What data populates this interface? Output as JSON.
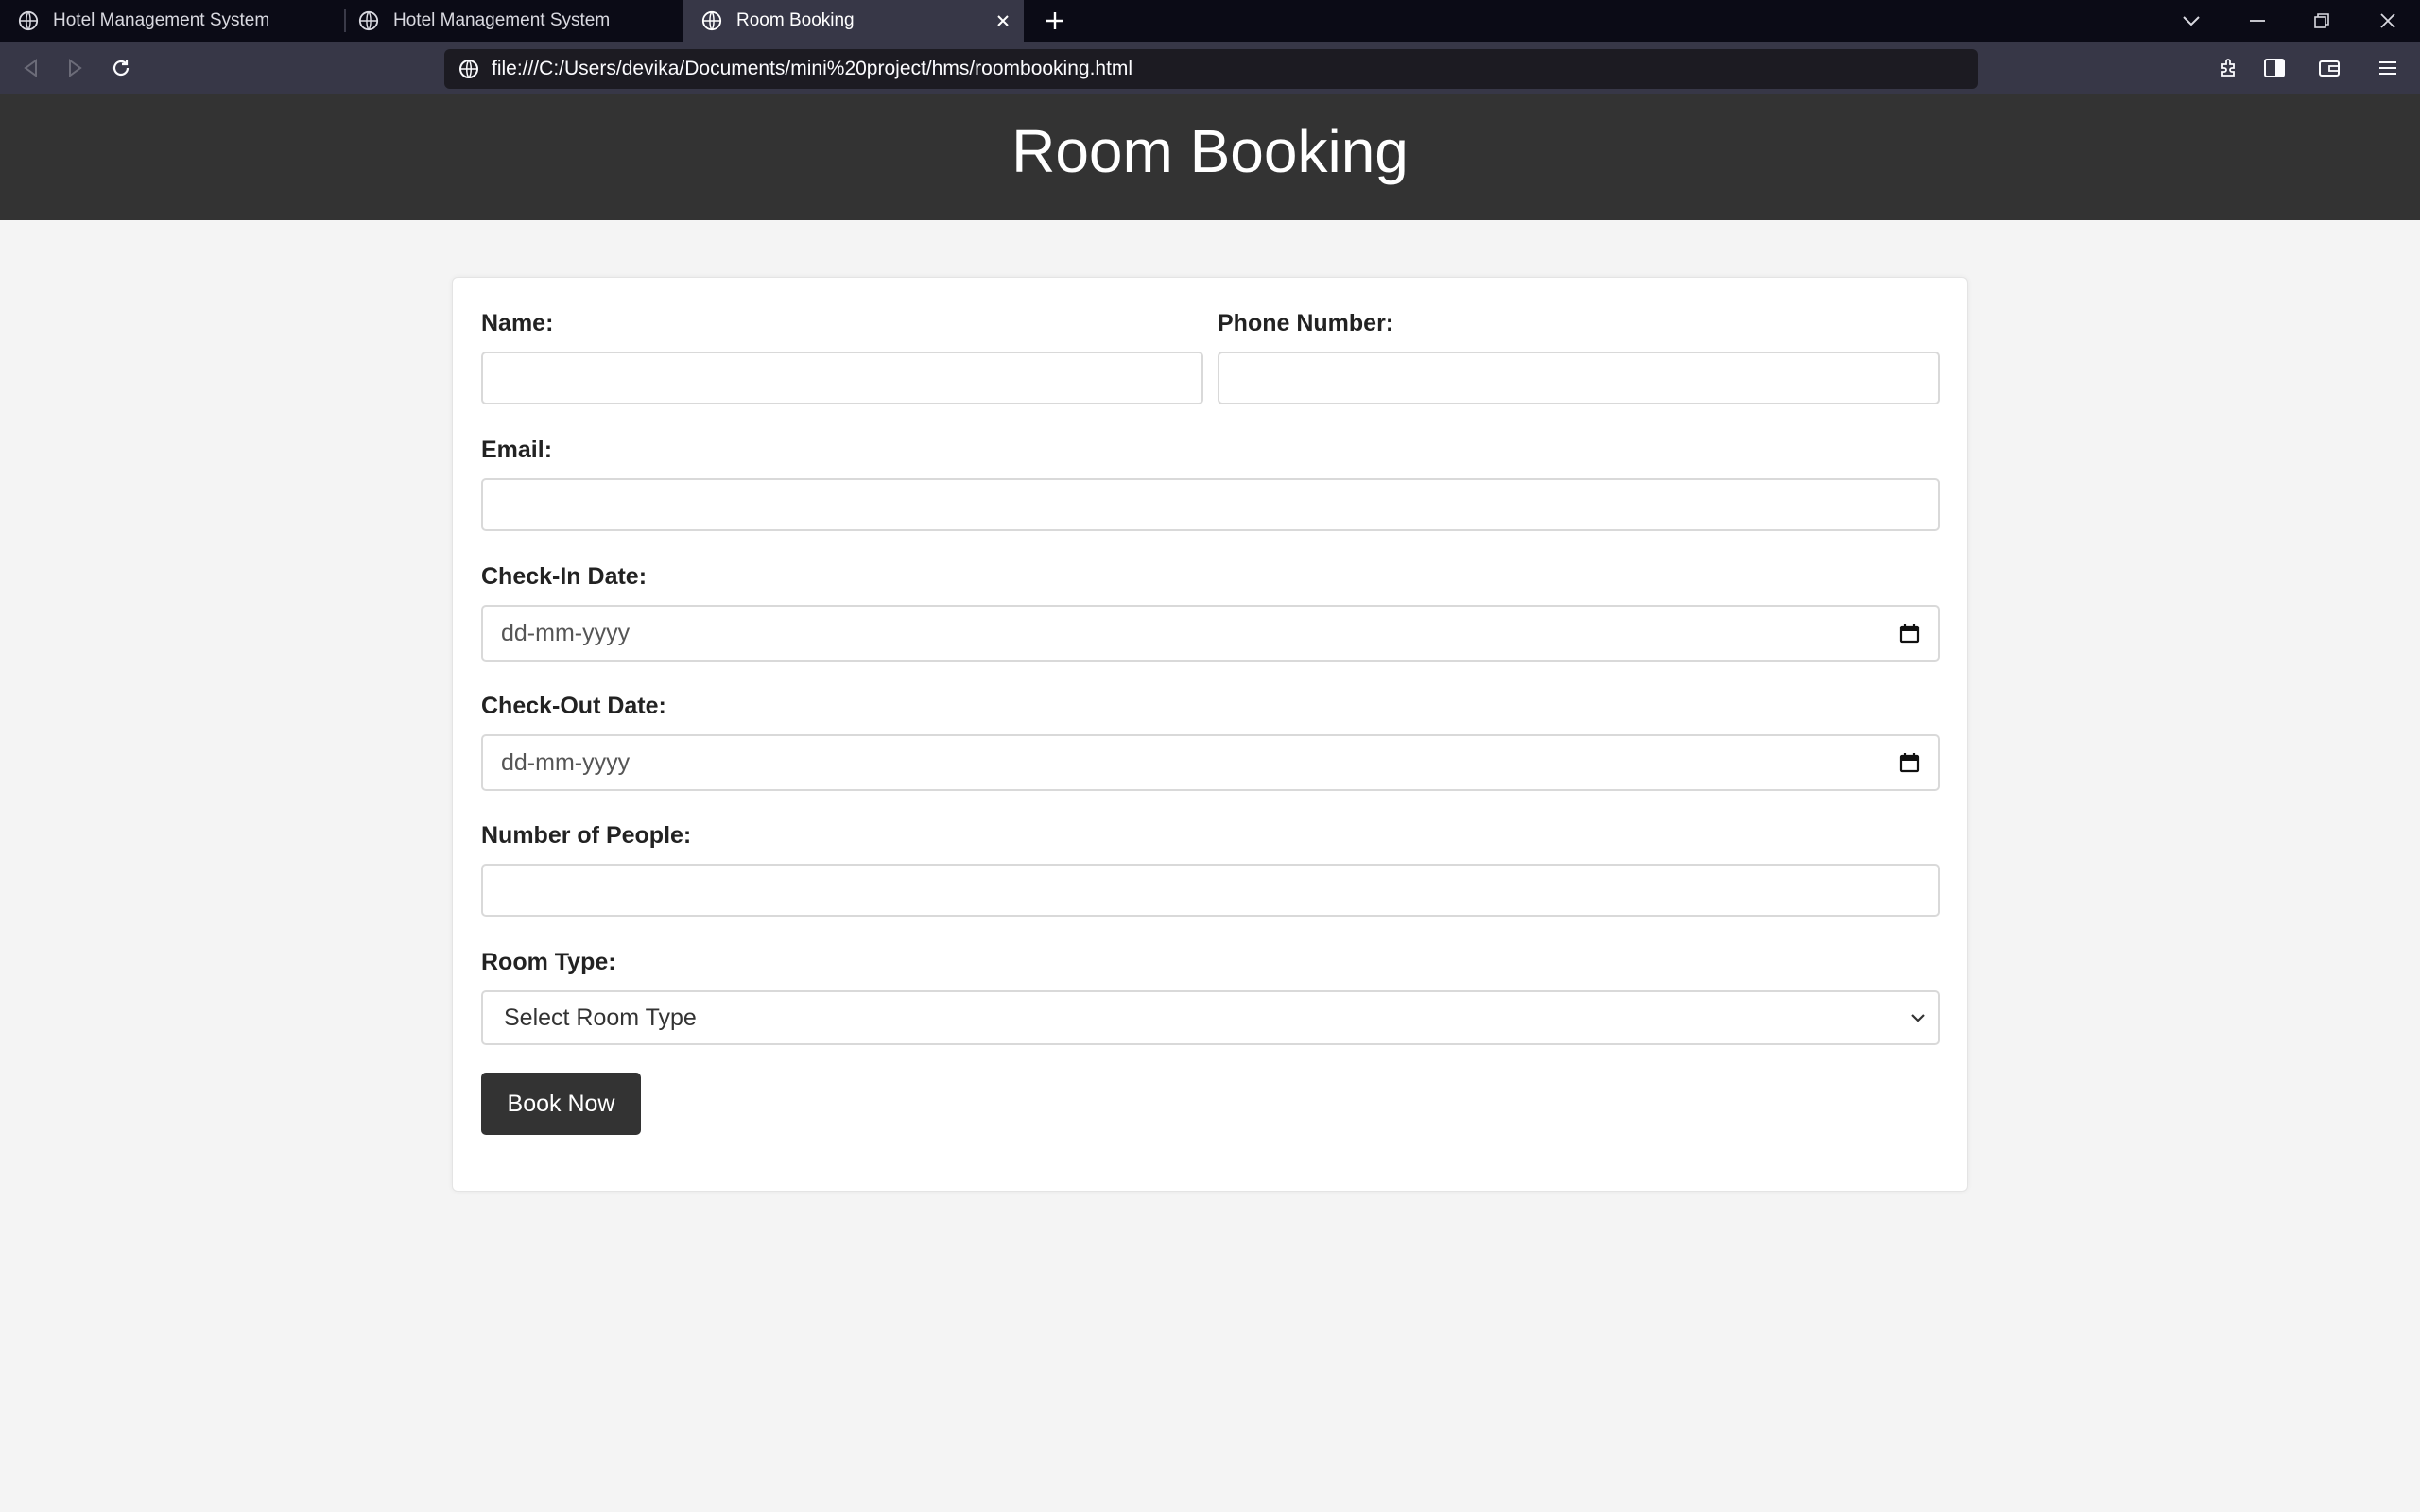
{
  "browser": {
    "tabs": [
      {
        "label": "Hotel Management System",
        "active": false
      },
      {
        "label": "Hotel Management System",
        "active": false
      },
      {
        "label": "Room Booking",
        "active": true
      }
    ],
    "url": "file:///C:/Users/devika/Documents/mini%20project/hms/roombooking.html",
    "icons": [
      "globe-icon",
      "close-icon",
      "plus-icon",
      "chevron-down-icon",
      "minimize-icon",
      "restore-icon",
      "close-window-icon",
      "back-icon",
      "forward-icon",
      "reload-icon",
      "page-info-icon",
      "extensions-icon",
      "sidebar-icon",
      "wallet-icon",
      "menu-icon"
    ]
  },
  "page": {
    "title": "Room Booking",
    "header_bg": "#333333",
    "page_bg": "#f4f4f4"
  },
  "form": {
    "name_label": "Name:",
    "phone_label": "Phone Number:",
    "email_label": "Email:",
    "checkin_label": "Check-In Date:",
    "checkin_placeholder": "dd-mm-yyyy",
    "checkout_label": "Check-Out Date:",
    "checkout_placeholder": "dd-mm-yyyy",
    "people_label": "Number of People:",
    "roomtype_label": "Room Type:",
    "roomtype_selected": "Select Room Type",
    "submit_label": "Book Now",
    "button_bg": "#333333"
  }
}
